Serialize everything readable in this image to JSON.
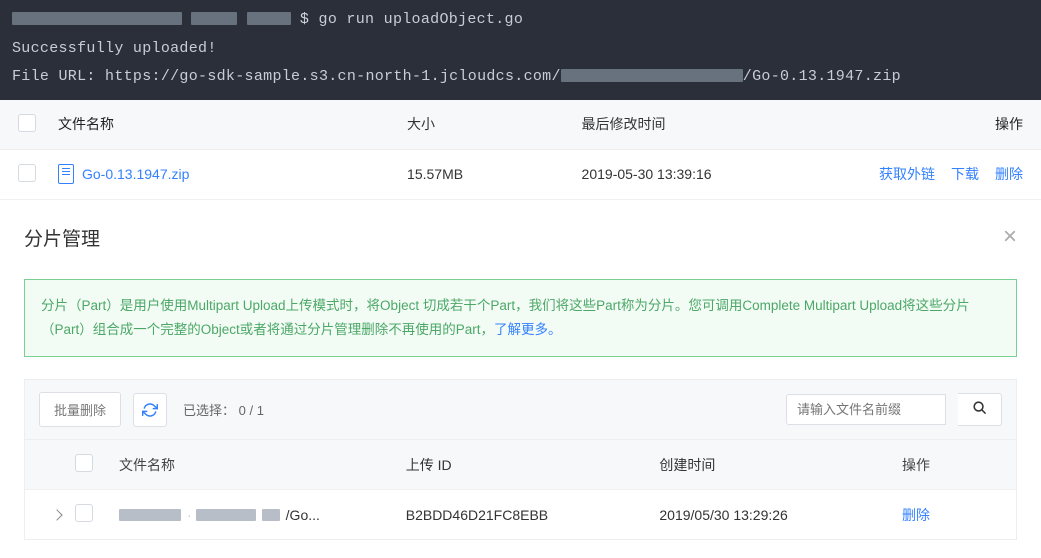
{
  "terminal": {
    "cmd": "go run uploadObject.go",
    "out1": "Successfully uploaded!",
    "out2_prefix": "File URL: https://go-sdk-sample.s3.cn-north-1.jcloudcs.com/",
    "out2_suffix": "/Go-0.13.1947.zip"
  },
  "file_table": {
    "headers": {
      "name": "文件名称",
      "size": "大小",
      "time": "最后修改时间",
      "act": "操作"
    },
    "row": {
      "name": "Go-0.13.1947.zip",
      "size": "15.57MB",
      "time": "2019-05-30 13:39:16",
      "act_link": "获取外链",
      "act_dl": "下载",
      "act_del": "删除"
    }
  },
  "panel": {
    "title": "分片管理",
    "info_a": "分片（Part）是用户使用Multipart Upload上传模式时，将Object 切成若干个Part，我们将这些Part称为分片。您可调用Complete Multipart Upload将这些分片（Part）组合成一个完整的Object或者将通过分片管理删除不再使用的Part，",
    "info_link": "了解更多。",
    "batch_del": "批量删除",
    "selected_label": "已选择：",
    "selected_count": "0 / 1",
    "search_placeholder": "请输入文件名前缀",
    "sub_headers": {
      "name": "文件名称",
      "id": "上传 ID",
      "time": "创建时间",
      "act": "操作"
    },
    "sub_row": {
      "name_suffix": "/Go...",
      "upload_id": "B2BDD46D21FC8EBB",
      "time": "2019/05/30 13:29:26",
      "del": "删除"
    }
  }
}
